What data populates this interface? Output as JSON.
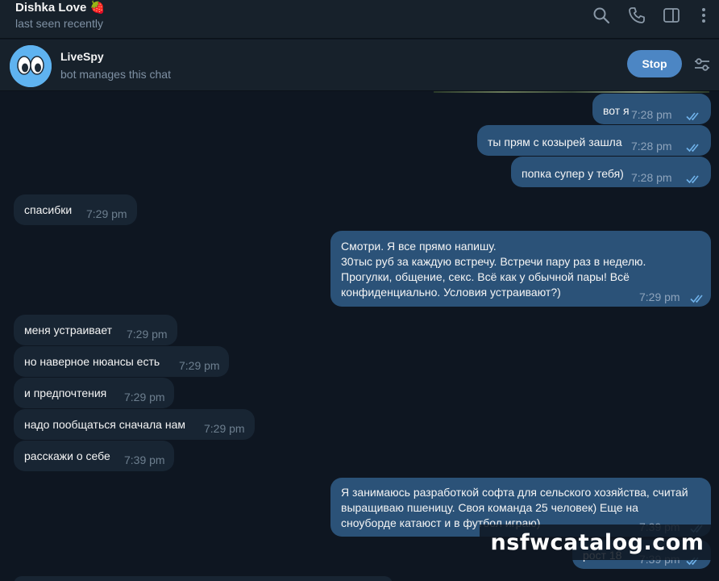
{
  "header": {
    "title": "Dishka Love",
    "title_emoji": "🍓",
    "status": "last seen recently",
    "icons": [
      "search-icon",
      "phone-icon",
      "sidebar-toggle-icon",
      "more-vertical-icon"
    ]
  },
  "bot": {
    "name": "LiveSpy",
    "subtitle": "bot manages this chat",
    "stop_label": "Stop",
    "avatar_icon": "eyes-emoji-icon",
    "settings_icon": "sliders-icon"
  },
  "messages": [
    {
      "dir": "out",
      "text": "вот я",
      "time": "7:28 pm"
    },
    {
      "dir": "out",
      "text": "ты прям с козырей зашла",
      "time": "7:28 pm"
    },
    {
      "dir": "out",
      "text": "попка супер у тебя)",
      "time": "7:28 pm"
    },
    {
      "dir": "in",
      "text": "спасибки",
      "time": "7:29 pm"
    },
    {
      "dir": "out",
      "lines": [
        "Смотри. Я все прямо напишу.",
        "30тыс руб за каждую встречу. Встречи пару раз в неделю.",
        "Прогулки, общение, секс. Всё как у обычной пары! Всё",
        "конфиденциально. Условия устраивают?)"
      ],
      "time": "7:29 pm"
    },
    {
      "dir": "in",
      "text": "меня устраивает",
      "time": "7:29 pm"
    },
    {
      "dir": "in",
      "text": "но наверное нюансы есть",
      "time": "7:29 pm"
    },
    {
      "dir": "in",
      "text": "и предпочтения",
      "time": "7:29 pm"
    },
    {
      "dir": "in",
      "text": "надо пообщаться сначала нам",
      "time": "7:29 pm"
    },
    {
      "dir": "in",
      "text": "расскажи о себе",
      "time": "7:39 pm"
    },
    {
      "dir": "out",
      "lines": [
        "Я занимаюсь разработкой софта для сельского хозяйства, считай",
        "выращиваю пшеницу. Своя команда 25 человек) Еще на",
        "сноуборде катаюст и в футбол играю)"
      ],
      "time": "7:39 pm"
    },
    {
      "dir": "out",
      "text": "рост 18",
      "time": "7:39 pm"
    }
  ],
  "watermark": "nsfwcatalog.com",
  "colors": {
    "background": "#0e1621",
    "header": "#17212b",
    "bubble_in": "#182533",
    "bubble_out": "#2b5278",
    "accent": "#4c86c4"
  }
}
